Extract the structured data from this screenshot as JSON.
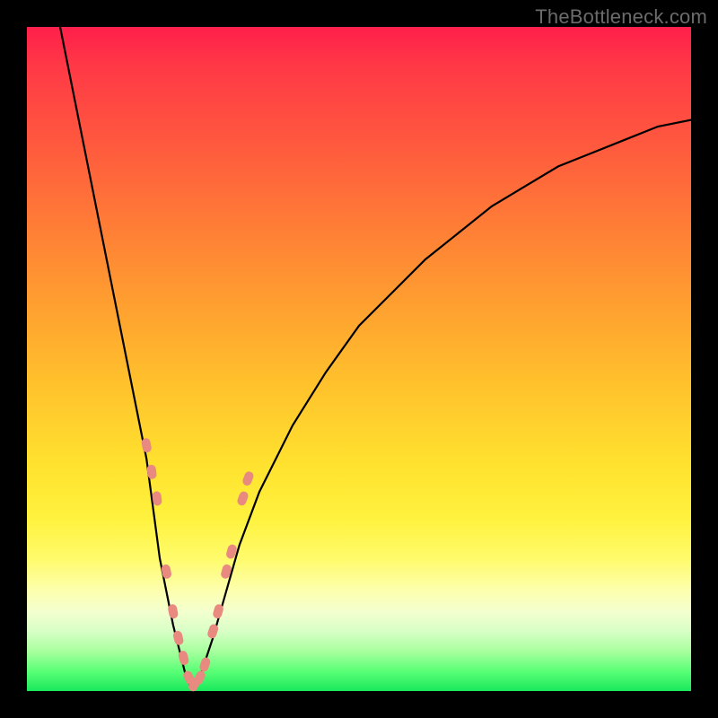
{
  "watermark": "TheBottleneck.com",
  "colors": {
    "frame": "#000000",
    "curve": "#000000",
    "marker_fill": "#e98a80",
    "marker_stroke": "#d87a70"
  },
  "chart_data": {
    "type": "line",
    "title": "",
    "xlabel": "",
    "ylabel": "",
    "xlim": [
      0,
      100
    ],
    "ylim": [
      0,
      100
    ],
    "grid": false,
    "legend": false,
    "curve": {
      "description": "V-shaped bottleneck curve; y≈0 at x≈25 (minimum), steep left branch, gentler right branch",
      "min_x": 25,
      "x": [
        5,
        8,
        10,
        12,
        14,
        16,
        18,
        20,
        21,
        22,
        23,
        24,
        25,
        26,
        27,
        28,
        30,
        32,
        35,
        40,
        45,
        50,
        55,
        60,
        65,
        70,
        75,
        80,
        85,
        90,
        95,
        100
      ],
      "y": [
        100,
        85,
        75,
        65,
        55,
        45,
        35,
        20,
        15,
        10,
        6,
        2,
        0,
        2,
        5,
        8,
        15,
        22,
        30,
        40,
        48,
        55,
        60,
        65,
        69,
        73,
        76,
        79,
        81,
        83,
        85,
        86
      ]
    },
    "series": [
      {
        "name": "sample-points",
        "marker": "pill",
        "x": [
          18.0,
          18.8,
          19.6,
          21.0,
          22.0,
          22.8,
          23.6,
          24.4,
          25.2,
          26.0,
          26.8,
          28.0,
          28.8,
          30.0,
          30.8,
          32.5,
          33.3
        ],
        "y": [
          37,
          33,
          29,
          18,
          12,
          8,
          5,
          2,
          1,
          2,
          4,
          9,
          12,
          18,
          21,
          29,
          32
        ]
      }
    ]
  }
}
